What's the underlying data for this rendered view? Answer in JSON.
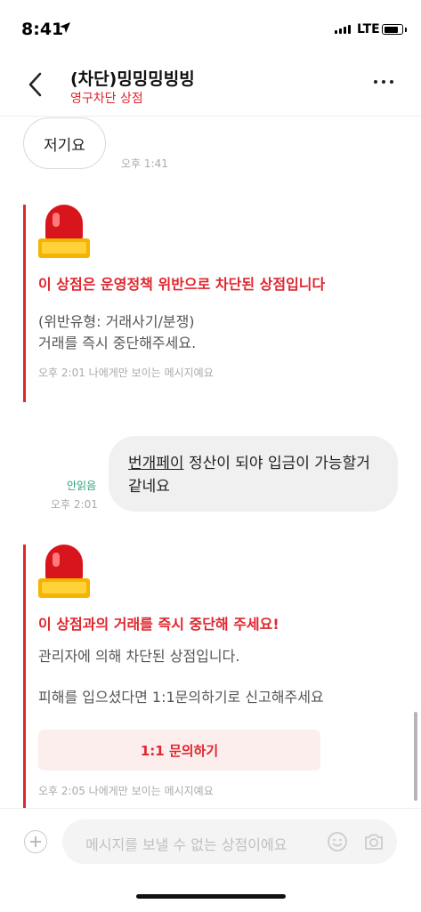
{
  "status_bar": {
    "time": "8:41",
    "network": "LTE",
    "battery_level": 0.85
  },
  "header": {
    "title": "(차단)밍밍밍빙빙",
    "subtitle": "영구차단 상점"
  },
  "messages": {
    "incoming": {
      "text": "저기요",
      "time": "오후 1:41"
    },
    "notice1": {
      "title": "이 상점은 운영정책 위반으로 차단된 상점입니다",
      "body_line1": "(위반유형: 거래사기/분쟁)",
      "body_line2": "거래를 즉시 중단해주세요.",
      "footer": "오후 2:01  나에게만 보이는 메시지예요"
    },
    "outgoing": {
      "link_text": "번개페이",
      "text": " 정산이 되야 입금이 가능할거 같네요",
      "status": "안읽음",
      "time": "오후 2:01"
    },
    "notice2": {
      "title": "이 상점과의 거래를 즉시 중단해 주세요!",
      "body_line1": "관리자에 의해 차단된 상점입니다.",
      "body_line2": "피해를 입으셨다면 1:1문의하기로 신고해주세요",
      "button": "1:1 문의하기",
      "footer": "오후 2:05  나에게만 보이는 메시지예요"
    }
  },
  "input_bar": {
    "placeholder": "메시지를 보낼 수 없는 상점이에요"
  },
  "colors": {
    "accent_red": "#e0262e",
    "unread_green": "#2fa37b"
  }
}
